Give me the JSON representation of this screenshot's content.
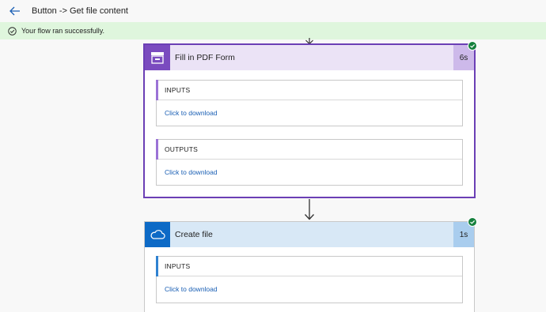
{
  "header": {
    "title": "Button -> Get file content"
  },
  "banner": {
    "message": "Your flow ran successfully."
  },
  "steps": [
    {
      "title": "Fill in PDF Form",
      "duration": "6s",
      "sections": [
        {
          "label": "INPUTS",
          "link": "Click to download"
        },
        {
          "label": "OUTPUTS",
          "link": "Click to download"
        }
      ]
    },
    {
      "title": "Create file",
      "duration": "1s",
      "sections": [
        {
          "label": "INPUTS",
          "link": "Click to download"
        }
      ]
    }
  ],
  "colors": {
    "pdf_accent": "#7a4bbf",
    "onedrive_accent": "#0d6ac6",
    "success_green": "#15803d",
    "link_blue": "#1a5fb4"
  }
}
